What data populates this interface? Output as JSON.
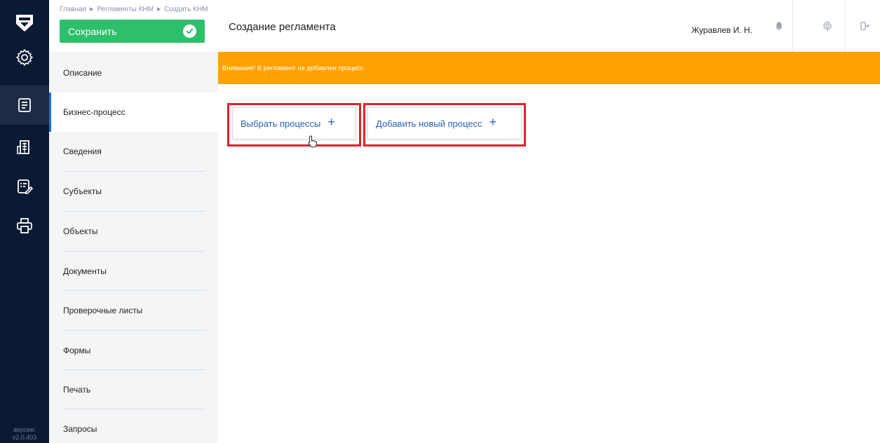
{
  "breadcrumb": [
    {
      "label": "Главная"
    },
    {
      "label": "Регламенты КНМ"
    },
    {
      "label": "Создать КНМ"
    }
  ],
  "toolbar": {
    "save_label": "Сохранить"
  },
  "page_title": "Создание регламента",
  "user": {
    "name": "Журавлев И. Н."
  },
  "rail": {
    "items": [
      {
        "icon": "settings-icon"
      },
      {
        "icon": "document-icon",
        "active": true
      },
      {
        "icon": "building-icon"
      },
      {
        "icon": "checklist-edit-icon"
      },
      {
        "icon": "printer-icon"
      }
    ],
    "version_label": "версия:",
    "version_value": "v2.0.403"
  },
  "subnav": {
    "items": [
      {
        "label": "Описание"
      },
      {
        "label": "Бизнес-процесс",
        "active": true
      },
      {
        "label": "Сведения"
      },
      {
        "label": "Субъекты"
      },
      {
        "label": "Объекты"
      },
      {
        "label": "Документы"
      },
      {
        "label": "Проверочные листы"
      },
      {
        "label": "Формы"
      },
      {
        "label": "Печать"
      },
      {
        "label": "Запросы"
      }
    ]
  },
  "alert": {
    "text": "Внимание! В регламент не добавлен процесс."
  },
  "actions": {
    "select_label": "Выбрать процессы",
    "add_label": "Добавить новый процесс",
    "plus": "+"
  },
  "colors": {
    "rail_bg": "#0b1a33",
    "save_green": "#2dbf6c",
    "alert_orange": "#ffa200",
    "link_blue": "#2a62b8",
    "highlight_red": "#e0202e",
    "active_accent": "#1e6fd9"
  }
}
